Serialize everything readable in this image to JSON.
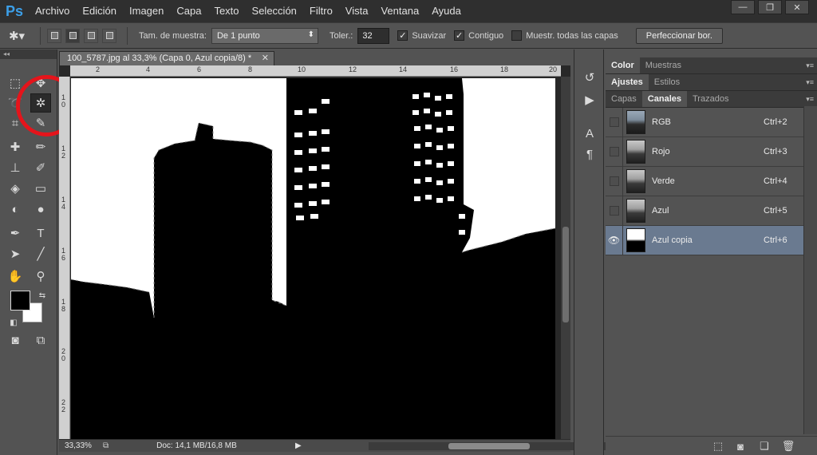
{
  "app": {
    "logo": "Ps"
  },
  "menu": [
    "Archivo",
    "Edición",
    "Imagen",
    "Capa",
    "Texto",
    "Selección",
    "Filtro",
    "Vista",
    "Ventana",
    "Ayuda"
  ],
  "window_controls": {
    "minimize": "—",
    "restore": "❐",
    "close": "✕"
  },
  "options": {
    "sample_size_label": "Tam. de muestra:",
    "sample_size_value": "De 1 punto",
    "tolerance_label": "Toler.:",
    "tolerance_value": "32",
    "antialias_label": "Suavizar",
    "antialias_checked": true,
    "contiguous_label": "Contiguo",
    "contiguous_checked": true,
    "sample_all_label": "Muestr. todas las capas",
    "sample_all_checked": false,
    "refine_edge_label": "Perfeccionar bor."
  },
  "document": {
    "tab_title": "100_5787.jpg al 33,3% (Capa 0, Azul copia/8) *",
    "ruler_top": [
      "2",
      "4",
      "6",
      "8",
      "10",
      "12",
      "14",
      "16",
      "18",
      "20"
    ],
    "ruler_left": [
      "1 0",
      "1 2",
      "1 4",
      "1 6",
      "1 8",
      "2 0",
      "2 2"
    ],
    "zoom": "33,33%",
    "doc_size": "Doc: 14,1 MB/16,8 MB"
  },
  "tools": {
    "active_tool": "magic-wand",
    "foreground_color": "#000000",
    "background_color": "#ffffff",
    "highlight_color": "#e5141b"
  },
  "panels": {
    "top_tabs": [
      "Color",
      "Muestras"
    ],
    "middle_tabs": [
      "Ajustes",
      "Estilos"
    ],
    "bottom_tabs": [
      "Capas",
      "Canales",
      "Trazados"
    ],
    "active_bottom_tab": "Canales",
    "channels": [
      {
        "name": "RGB",
        "shortcut": "Ctrl+2",
        "visible": false,
        "selected": false
      },
      {
        "name": "Rojo",
        "shortcut": "Ctrl+3",
        "visible": false,
        "selected": false
      },
      {
        "name": "Verde",
        "shortcut": "Ctrl+4",
        "visible": false,
        "selected": false
      },
      {
        "name": "Azul",
        "shortcut": "Ctrl+5",
        "visible": false,
        "selected": false
      },
      {
        "name": "Azul copia",
        "shortcut": "Ctrl+6",
        "visible": true,
        "selected": true
      }
    ]
  }
}
